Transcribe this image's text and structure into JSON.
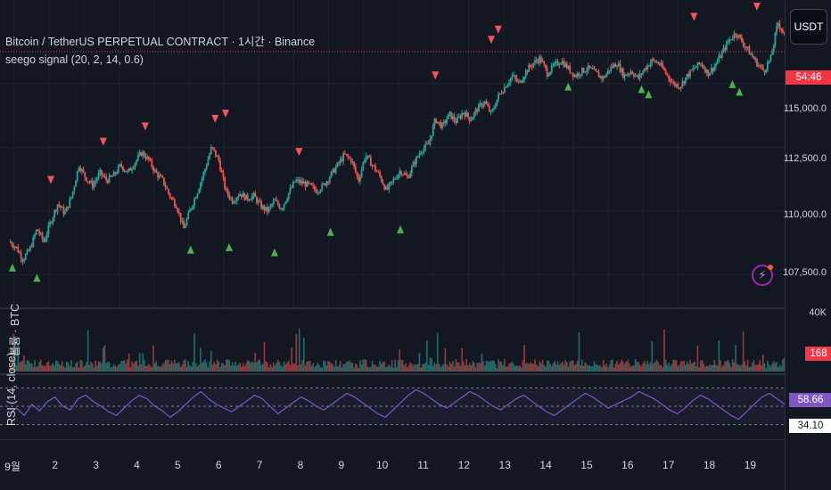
{
  "header": {
    "symbol_title": "Bitcoin / TetherUS PERPETUAL CONTRACT · 1시간 · Binance",
    "indicator_title": "seego signal (20, 2, 14, 0.6)",
    "volume_label": "볼륨 · BTC",
    "rsi_label": "RSI (14, close)"
  },
  "currency_button": "USDT",
  "price_axis": {
    "ticks": [
      "115,000.0",
      "112,500.0",
      "110,000.0",
      "107,500.0"
    ],
    "countdown": "54:46"
  },
  "volume_axis": {
    "top_tick": "40K",
    "current": "168"
  },
  "rsi_axis": {
    "current": "58.66",
    "level": "34.10"
  },
  "time_axis": [
    "9월",
    "2",
    "3",
    "4",
    "5",
    "6",
    "7",
    "8",
    "9",
    "10",
    "11",
    "12",
    "13",
    "14",
    "15",
    "16",
    "17",
    "18",
    "19"
  ],
  "colors": {
    "bg": "#131722",
    "up": "#26a69a",
    "down": "#ef5350",
    "sell_signal": "#f7525f",
    "buy_signal": "#4caf50",
    "rsi_line": "#7e57c2",
    "price_line": "#f23645"
  },
  "chart_data": {
    "type": "candlestick",
    "ylim": [
      106500,
      118000
    ],
    "price_ticks": [
      115000,
      112500,
      110000,
      107500
    ],
    "close_path": [
      [
        0.0,
        108800
      ],
      [
        0.2,
        108600
      ],
      [
        0.4,
        108100
      ],
      [
        0.6,
        108500
      ],
      [
        0.8,
        109300
      ],
      [
        1.0,
        108800
      ],
      [
        1.2,
        109600
      ],
      [
        1.4,
        110300
      ],
      [
        1.6,
        109900
      ],
      [
        1.8,
        110600
      ],
      [
        2.0,
        111800
      ],
      [
        2.2,
        111300
      ],
      [
        2.4,
        111000
      ],
      [
        2.6,
        111500
      ],
      [
        2.8,
        111200
      ],
      [
        3.0,
        111400
      ],
      [
        3.2,
        111800
      ],
      [
        3.4,
        111500
      ],
      [
        3.6,
        111900
      ],
      [
        3.8,
        112300
      ],
      [
        4.0,
        112000
      ],
      [
        4.2,
        111500
      ],
      [
        4.4,
        111200
      ],
      [
        4.6,
        110600
      ],
      [
        4.8,
        110200
      ],
      [
        5.0,
        109300
      ],
      [
        5.2,
        110100
      ],
      [
        5.4,
        110800
      ],
      [
        5.6,
        111600
      ],
      [
        5.8,
        112500
      ],
      [
        6.0,
        112000
      ],
      [
        6.2,
        110800
      ],
      [
        6.4,
        110400
      ],
      [
        6.6,
        110700
      ],
      [
        6.8,
        110500
      ],
      [
        7.0,
        110600
      ],
      [
        7.2,
        110200
      ],
      [
        7.4,
        110000
      ],
      [
        7.6,
        110400
      ],
      [
        7.8,
        110100
      ],
      [
        8.0,
        110700
      ],
      [
        8.2,
        111200
      ],
      [
        8.4,
        111100
      ],
      [
        8.6,
        111000
      ],
      [
        8.8,
        110800
      ],
      [
        9.0,
        111000
      ],
      [
        9.2,
        111400
      ],
      [
        9.4,
        111800
      ],
      [
        9.6,
        112200
      ],
      [
        9.8,
        112000
      ],
      [
        10.0,
        111200
      ],
      [
        10.2,
        112200
      ],
      [
        10.4,
        111800
      ],
      [
        10.6,
        111400
      ],
      [
        10.8,
        110800
      ],
      [
        11.0,
        111200
      ],
      [
        11.2,
        111600
      ],
      [
        11.4,
        111300
      ],
      [
        11.6,
        111900
      ],
      [
        11.8,
        112400
      ],
      [
        12.0,
        112600
      ],
      [
        12.2,
        113600
      ],
      [
        12.4,
        113300
      ],
      [
        12.6,
        113800
      ],
      [
        12.8,
        113500
      ],
      [
        13.0,
        113900
      ],
      [
        13.2,
        113600
      ],
      [
        13.4,
        114000
      ],
      [
        13.6,
        114300
      ],
      [
        13.8,
        113800
      ],
      [
        14.0,
        114500
      ],
      [
        14.2,
        114900
      ],
      [
        14.4,
        115300
      ],
      [
        14.6,
        115000
      ],
      [
        14.8,
        115500
      ],
      [
        15.0,
        115800
      ],
      [
        15.2,
        116000
      ],
      [
        15.4,
        115400
      ],
      [
        15.6,
        115700
      ],
      [
        15.8,
        115900
      ],
      [
        16.0,
        115600
      ],
      [
        16.2,
        115300
      ],
      [
        16.4,
        115500
      ],
      [
        16.6,
        115600
      ],
      [
        16.8,
        115400
      ],
      [
        17.0,
        115200
      ],
      [
        17.2,
        115600
      ],
      [
        17.4,
        115800
      ],
      [
        17.6,
        115300
      ],
      [
        17.8,
        115500
      ],
      [
        18.0,
        115200
      ],
      [
        18.2,
        115600
      ],
      [
        18.4,
        115900
      ],
      [
        18.6,
        115800
      ],
      [
        18.8,
        115400
      ],
      [
        19.0,
        115000
      ],
      [
        19.2,
        114900
      ],
      [
        19.4,
        115300
      ],
      [
        19.6,
        115600
      ],
      [
        19.8,
        115800
      ],
      [
        20.0,
        115400
      ],
      [
        20.2,
        115700
      ],
      [
        20.4,
        116200
      ],
      [
        20.6,
        116700
      ],
      [
        20.8,
        117000
      ],
      [
        21.0,
        116600
      ],
      [
        21.2,
        116200
      ],
      [
        21.4,
        115800
      ],
      [
        21.6,
        115500
      ],
      [
        21.8,
        116000
      ],
      [
        22.0,
        117400
      ],
      [
        22.2,
        116900
      ]
    ],
    "sell_signals": [
      {
        "t": 1.2,
        "p": 111200
      },
      {
        "t": 2.7,
        "p": 112700
      },
      {
        "t": 3.9,
        "p": 113300
      },
      {
        "t": 5.9,
        "p": 113600
      },
      {
        "t": 6.2,
        "p": 113800
      },
      {
        "t": 8.3,
        "p": 112300
      },
      {
        "t": 12.2,
        "p": 115300
      },
      {
        "t": 13.8,
        "p": 116700
      },
      {
        "t": 14.0,
        "p": 117100
      },
      {
        "t": 19.6,
        "p": 117600
      },
      {
        "t": 21.4,
        "p": 118000
      }
    ],
    "buy_signals": [
      {
        "t": 0.1,
        "p": 107800
      },
      {
        "t": 0.8,
        "p": 107400
      },
      {
        "t": 5.2,
        "p": 108500
      },
      {
        "t": 6.3,
        "p": 108600
      },
      {
        "t": 7.6,
        "p": 108400
      },
      {
        "t": 9.2,
        "p": 109200
      },
      {
        "t": 11.2,
        "p": 109300
      },
      {
        "t": 16.0,
        "p": 114900
      },
      {
        "t": 18.1,
        "p": 114800
      },
      {
        "t": 18.3,
        "p": 114600
      },
      {
        "t": 20.7,
        "p": 115000
      },
      {
        "t": 20.9,
        "p": 114700
      }
    ],
    "rsi": {
      "ylim": [
        20,
        80
      ],
      "overbought": 70,
      "mid": 50,
      "oversold": 30,
      "values": [
        42,
        48,
        40,
        52,
        45,
        55,
        60,
        50,
        46,
        58,
        62,
        55,
        50,
        44,
        40,
        48,
        56,
        62,
        58,
        50,
        45,
        38,
        44,
        52,
        60,
        66,
        58,
        52,
        48,
        44,
        50,
        56,
        62,
        58,
        50,
        42,
        48,
        54,
        60,
        56,
        50,
        46,
        52,
        58,
        64,
        60,
        54,
        48,
        42,
        38,
        46,
        54,
        62,
        68,
        64,
        58,
        52,
        48,
        54,
        60,
        66,
        62,
        56,
        50,
        46,
        52,
        58,
        62,
        56,
        50,
        44,
        40,
        46,
        52,
        58,
        64,
        60,
        54,
        48,
        52,
        56,
        60,
        66,
        62,
        58,
        52,
        46,
        42,
        48,
        56,
        62,
        58,
        52,
        46,
        40,
        36,
        44,
        52,
        60,
        64,
        58,
        52
      ]
    }
  }
}
